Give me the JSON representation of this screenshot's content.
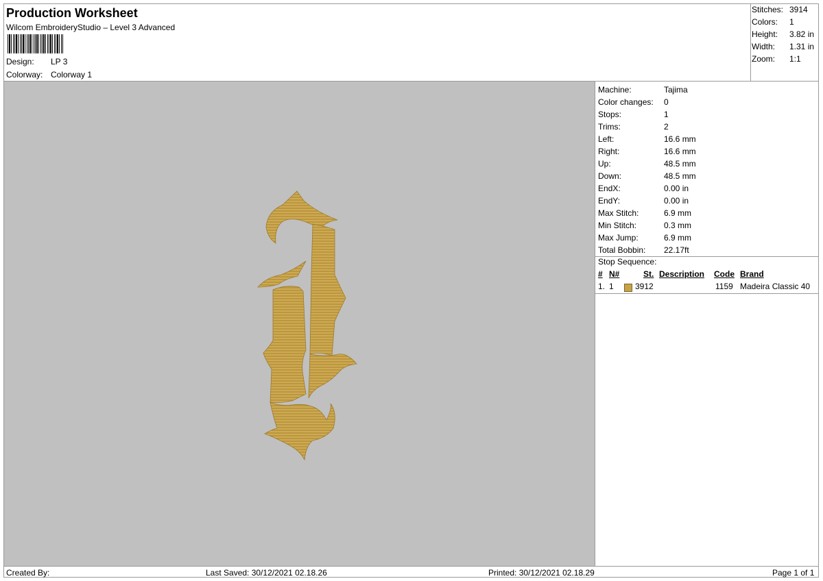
{
  "header": {
    "title": "Production Worksheet",
    "subtitle": "Wilcom EmbroideryStudio – Level 3 Advanced",
    "design_label": "Design:",
    "design_value": "LP 3",
    "colorway_label": "Colorway:",
    "colorway_value": "Colorway 1"
  },
  "summary": [
    {
      "label": "Stitches:",
      "value": "3914"
    },
    {
      "label": "Colors:",
      "value": "1"
    },
    {
      "label": "Height:",
      "value": "3.82 in"
    },
    {
      "label": "Width:",
      "value": "1.31 in"
    },
    {
      "label": "Zoom:",
      "value": "1:1"
    }
  ],
  "machine_info": [
    {
      "label": "Machine:",
      "value": "Tajima"
    },
    {
      "label": "Color changes:",
      "value": "0"
    },
    {
      "label": "Stops:",
      "value": "1"
    },
    {
      "label": "Trims:",
      "value": "2"
    },
    {
      "label": "Left:",
      "value": "16.6 mm"
    },
    {
      "label": "Right:",
      "value": "16.6 mm"
    },
    {
      "label": "Up:",
      "value": "48.5 mm"
    },
    {
      "label": "Down:",
      "value": "48.5 mm"
    },
    {
      "label": "EndX:",
      "value": "0.00 in"
    },
    {
      "label": "EndY:",
      "value": "0.00 in"
    },
    {
      "label": "Max Stitch:",
      "value": "6.9 mm"
    },
    {
      "label": "Min Stitch:",
      "value": "0.3 mm"
    },
    {
      "label": "Max Jump:",
      "value": "6.9 mm"
    },
    {
      "label": "Total Bobbin:",
      "value": "22.17ft"
    }
  ],
  "stop_sequence": {
    "title": "Stop Sequence:",
    "columns": [
      "#",
      "N#",
      "St.",
      "Description",
      "Code",
      "Brand"
    ],
    "rows": [
      {
        "index": "1.",
        "n": "1",
        "stitches": "3912",
        "description": "",
        "code": "1159",
        "brand": "Madeira Classic 40",
        "color": "#c8a24a"
      }
    ]
  },
  "footer": {
    "created_by": "Created By:",
    "last_saved": "Last Saved: 30/12/2021 02.18.26",
    "printed": "Printed: 30/12/2021 02.18.29",
    "page": "Page 1 of 1"
  },
  "colors": {
    "canvas": "#c0c0c0",
    "thread": "#c8a24a"
  }
}
